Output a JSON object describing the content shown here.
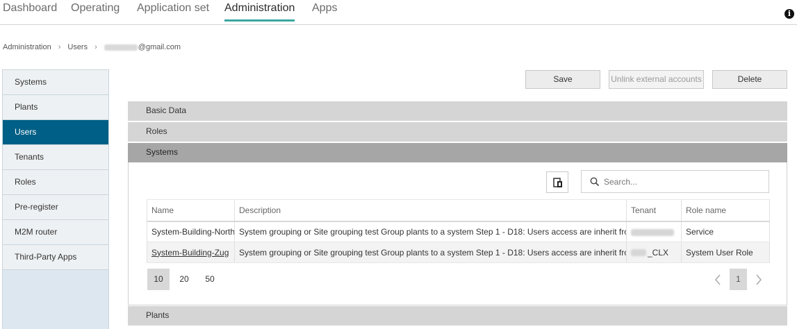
{
  "topnav": {
    "tabs": [
      {
        "label": "Dashboard"
      },
      {
        "label": "Operating"
      },
      {
        "label": "Application set"
      },
      {
        "label": "Administration"
      },
      {
        "label": "Apps"
      }
    ],
    "active_tab": "Administration",
    "accent_color": "#3aa6a0"
  },
  "breadcrumb": {
    "items": [
      "Administration",
      "Users"
    ],
    "email_suffix": "@gmail.com"
  },
  "sidebar": {
    "items": [
      {
        "label": "Systems"
      },
      {
        "label": "Plants"
      },
      {
        "label": "Users"
      },
      {
        "label": "Tenants"
      },
      {
        "label": "Roles"
      },
      {
        "label": "Pre-register"
      },
      {
        "label": "M2M router"
      },
      {
        "label": "Third-Party Apps"
      }
    ],
    "active": "Users",
    "active_color": "#005f86"
  },
  "actions": {
    "save": "Save",
    "unlink": "Unlink external accounts",
    "delete": "Delete"
  },
  "sections": {
    "basic_data": "Basic Data",
    "roles": "Roles",
    "systems": "Systems",
    "plants": "Plants"
  },
  "systems_panel": {
    "search_placeholder": "Search...",
    "columns": [
      "Name",
      "Description",
      "Tenant",
      "Role name"
    ],
    "rows": [
      {
        "name": "System-Building-North",
        "description": "System grouping or Site grouping test Group plants to a system Step 1 - D18: Users access are inherit from Sy",
        "tenant": "",
        "role": "Service"
      },
      {
        "name": "System-Building-Zug",
        "description": "System grouping or Site grouping test Group plants to a system Step 1 - D18: Users access are inherit from Sy",
        "tenant": "_CLX",
        "role": "System User Role"
      }
    ],
    "page_sizes": [
      "10",
      "20",
      "50"
    ],
    "current_page": "1"
  }
}
